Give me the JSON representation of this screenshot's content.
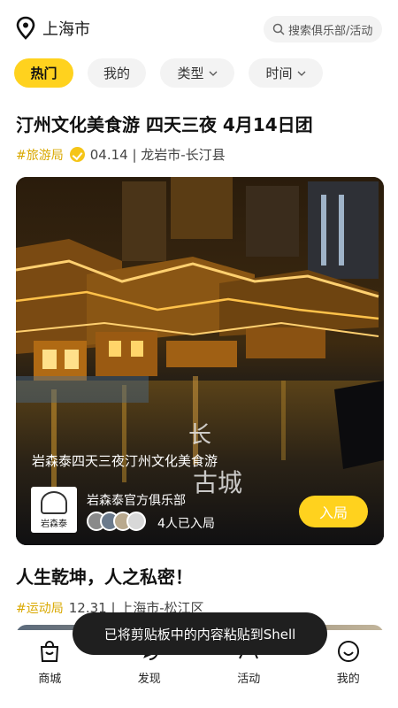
{
  "header": {
    "city": "上海市",
    "search_placeholder": "搜索俱乐部/活动"
  },
  "filters": [
    {
      "label": "热门",
      "active": true,
      "has_dropdown": false
    },
    {
      "label": "我的",
      "active": false,
      "has_dropdown": false
    },
    {
      "label": "类型",
      "active": false,
      "has_dropdown": true
    },
    {
      "label": "时间",
      "active": false,
      "has_dropdown": true
    }
  ],
  "posts": [
    {
      "title": "汀州文化美食游 四天三夜 4月14日团",
      "tag": "#旅游局",
      "verified": true,
      "meta": "04.14 | 龙岩市-长汀县",
      "caption": "岩森泰四天三夜汀州文化美食游",
      "club_name": "岩森泰官方俱乐部",
      "club_logo_text": "岩森泰",
      "joined": "4人已入局",
      "join_button": "入局"
    },
    {
      "title": "人生乾坤，人之私密！",
      "tag": "#运动局",
      "meta": "12.31 | 上海市-松江区"
    }
  ],
  "nav": [
    {
      "label": "商城",
      "icon": "shopping-bag-icon"
    },
    {
      "label": "发现",
      "icon": "discover-icon"
    },
    {
      "label": "活动",
      "icon": "activity-icon"
    },
    {
      "label": "我的",
      "icon": "profile-icon"
    }
  ],
  "toast": "已将剪贴板中的内容粘贴到Shell",
  "colors": {
    "accent": "#ffd21e",
    "tag": "#d9a800"
  }
}
